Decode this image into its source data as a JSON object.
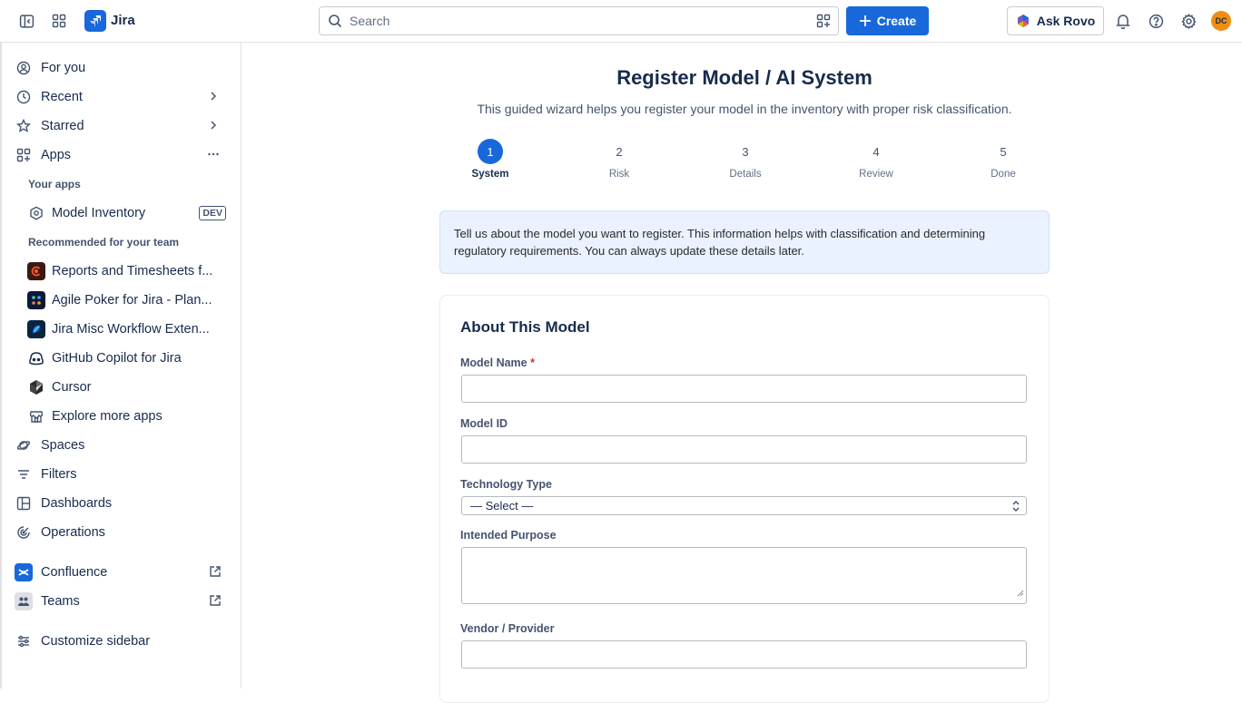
{
  "topbar": {
    "app_name": "Jira",
    "search_placeholder": "Search",
    "create_label": "Create",
    "rovo_label": "Ask Rovo",
    "avatar_initials": "DC",
    "brand_color": "#1868db"
  },
  "sidebar": {
    "for_you": "For you",
    "recent": "Recent",
    "starred": "Starred",
    "apps": "Apps",
    "your_apps_heading": "Your apps",
    "model_inventory": "Model Inventory",
    "dev_badge": "DEV",
    "recommended_heading": "Recommended for your team",
    "recommended": [
      {
        "label": "Reports and Timesheets f..."
      },
      {
        "label": "Agile Poker for Jira - Plan..."
      },
      {
        "label": "Jira Misc Workflow Exten..."
      },
      {
        "label": "GitHub Copilot for Jira"
      },
      {
        "label": "Cursor"
      }
    ],
    "explore": "Explore more apps",
    "spaces": "Spaces",
    "filters": "Filters",
    "dashboards": "Dashboards",
    "operations": "Operations",
    "confluence": "Confluence",
    "teams": "Teams",
    "customize": "Customize sidebar"
  },
  "main": {
    "title": "Register Model / AI System",
    "subtitle": "This guided wizard helps you register your model in the inventory with proper risk classification.",
    "steps": [
      {
        "num": "1",
        "label": "System"
      },
      {
        "num": "2",
        "label": "Risk"
      },
      {
        "num": "3",
        "label": "Details"
      },
      {
        "num": "4",
        "label": "Review"
      },
      {
        "num": "5",
        "label": "Done"
      }
    ],
    "active_step": 1,
    "info_text": "Tell us about the model you want to register. This information helps with classification and determining regulatory requirements. You can always update these details later.",
    "card_title": "About This Model",
    "fields": {
      "model_name_label": "Model Name",
      "required_mark": "*",
      "model_name_value": "",
      "model_id_label": "Model ID",
      "model_id_value": "",
      "tech_type_label": "Technology Type",
      "tech_type_value": "— Select —",
      "purpose_label": "Intended Purpose",
      "purpose_value": "",
      "vendor_label": "Vendor / Provider",
      "vendor_value": ""
    }
  }
}
